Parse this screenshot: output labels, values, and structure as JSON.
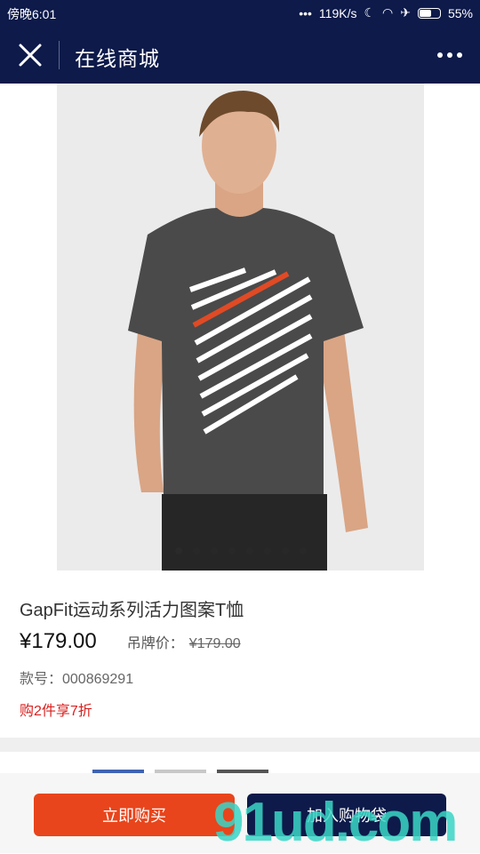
{
  "status_bar": {
    "time": "傍晚6:01",
    "dots": "•••",
    "speed": "119K/s",
    "battery": "55%",
    "battery_level": 0.55
  },
  "header": {
    "title": "在线商城"
  },
  "product": {
    "name": "GapFit运动系列活力图案T恤",
    "price": "¥179.00",
    "tag_label": "吊牌价：",
    "tag_price": "¥179.00",
    "sku": "款号：000869291",
    "promo": "购2件享7折"
  },
  "carousel": {
    "count": 8,
    "active_index": 0
  },
  "swatches": [
    "#3f63b3",
    "#c8c8c8",
    "#555555"
  ],
  "actions": {
    "buy_now": "立即购买",
    "add_to_cart": "加入购物袋"
  },
  "watermark": "91ud.com"
}
